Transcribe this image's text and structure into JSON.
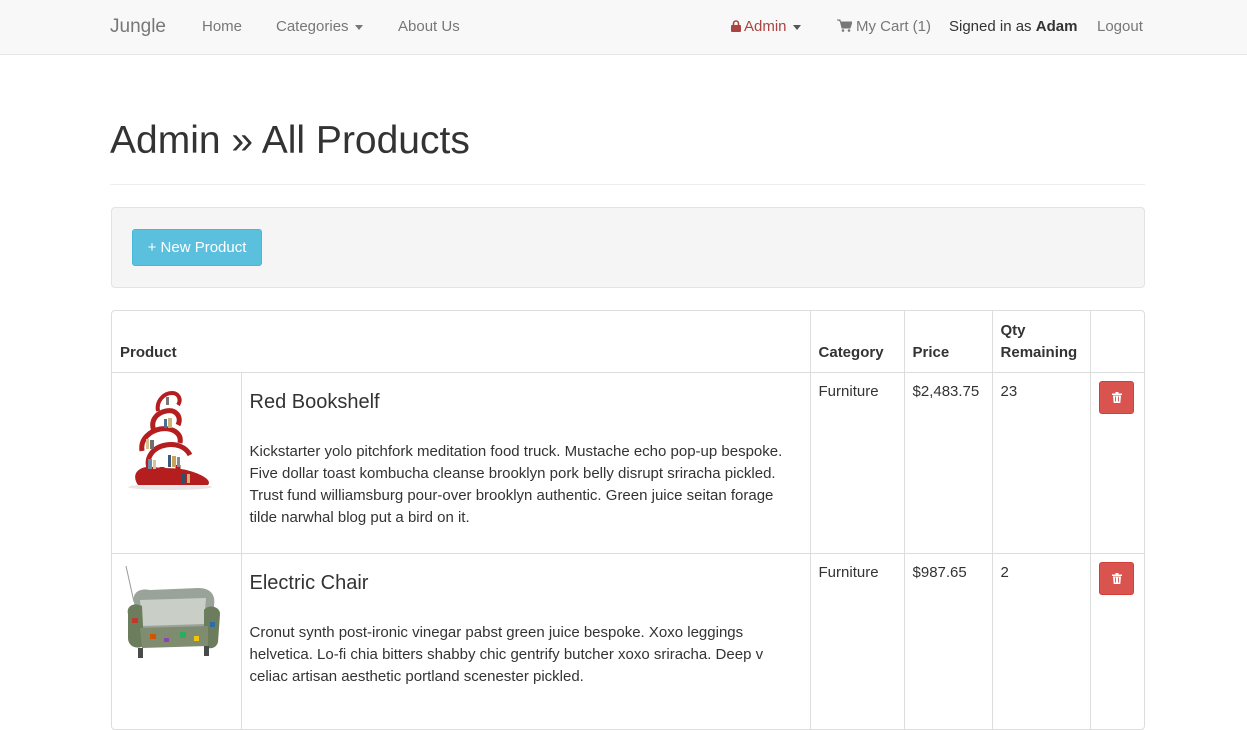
{
  "navbar": {
    "brand": "Jungle",
    "home": "Home",
    "categories": "Categories",
    "about": "About Us",
    "admin": "Admin",
    "cart": "My Cart (1)",
    "signed_in_prefix": "Signed in as",
    "user": "Adam",
    "logout": "Logout"
  },
  "page": {
    "title": "Admin » All Products",
    "new_product": "+ New Product"
  },
  "table": {
    "headers": {
      "product": "Product",
      "category": "Category",
      "price": "Price",
      "qty": "Qty Remaining"
    },
    "rows": [
      {
        "name": "Red Bookshelf",
        "description": "Kickstarter yolo pitchfork meditation food truck. Mustache echo pop-up bespoke. Five dollar toast kombucha cleanse brooklyn pork belly disrupt sriracha pickled. Trust fund williamsburg pour-over brooklyn authentic. Green juice seitan forage tilde narwhal blog put a bird on it.",
        "category": "Furniture",
        "price": "$2,483.75",
        "qty": "23"
      },
      {
        "name": "Electric Chair",
        "description": "Cronut synth post-ironic vinegar pabst green juice bespoke. Xoxo leggings helvetica. Lo-fi chia bitters shabby chic gentrify butcher xoxo sriracha. Deep v celiac artisan aesthetic portland scenester pickled.",
        "category": "Furniture",
        "price": "$987.65",
        "qty": "2"
      }
    ]
  },
  "colors": {
    "navbar_bg": "#f8f8f8",
    "admin_link": "#a94442",
    "info_button": "#5bc0de",
    "danger_button": "#d9534f"
  },
  "icons": {
    "admin": "lock-icon",
    "cart": "shopping-cart-icon",
    "delete": "trash-icon"
  }
}
